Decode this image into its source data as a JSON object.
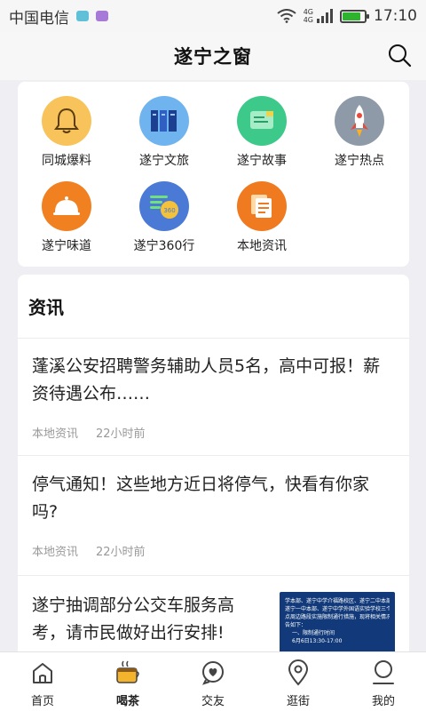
{
  "status": {
    "carrier": "中国电信",
    "net_top": "4G",
    "net_bottom": "4G",
    "time": "17:10",
    "battery_level": 0.85
  },
  "header": {
    "title": "遂宁之窗"
  },
  "grid": [
    {
      "label": "同城爆料",
      "icon": "bell-icon",
      "color": "#f7c35a"
    },
    {
      "label": "遂宁文旅",
      "icon": "books-icon",
      "color": "#6fb4ef"
    },
    {
      "label": "遂宁故事",
      "icon": "chat-doc-icon",
      "color": "#3cc98a"
    },
    {
      "label": "遂宁热点",
      "icon": "rocket-icon",
      "color": "#8e9aa8"
    },
    {
      "label": "遂宁味道",
      "icon": "food-cloche-icon",
      "color": "#f08020"
    },
    {
      "label": "遂宁360行",
      "icon": "list-360-icon",
      "color": "#4a7ad6"
    },
    {
      "label": "本地资讯",
      "icon": "documents-icon",
      "color": "#f07a20"
    }
  ],
  "news": {
    "heading": "资讯",
    "items": [
      {
        "title": "蓬溪公安招聘警务辅助人员5名，高中可报！薪资待遇公布……",
        "source": "本地资讯",
        "time": "22小时前"
      },
      {
        "title": "停气通知！这些地方近日将停气，快看有你家吗?",
        "source": "本地资讯",
        "time": "22小时前"
      },
      {
        "title": "遂宁抽调部分公交车服务高考，请市民做好出行安排!",
        "thumb_lines": [
          "学本部、遂宁中学介福路校区、遂宁二中本部、",
          "遂宁一中本部、遂宁中学外国语实验学校三个考",
          "点周边路段实施限制通行措施，现将相关情况通",
          "告如下：",
          "一、限制通行时间",
          "6月6日13:30-17:00"
        ]
      }
    ]
  },
  "tabs": [
    {
      "label": "首页",
      "icon": "home-icon"
    },
    {
      "label": "喝茶",
      "icon": "tea-cup-icon",
      "active": true
    },
    {
      "label": "交友",
      "icon": "heart-chat-icon"
    },
    {
      "label": "逛街",
      "icon": "location-pin-icon"
    },
    {
      "label": "我的",
      "icon": "user-icon"
    }
  ]
}
